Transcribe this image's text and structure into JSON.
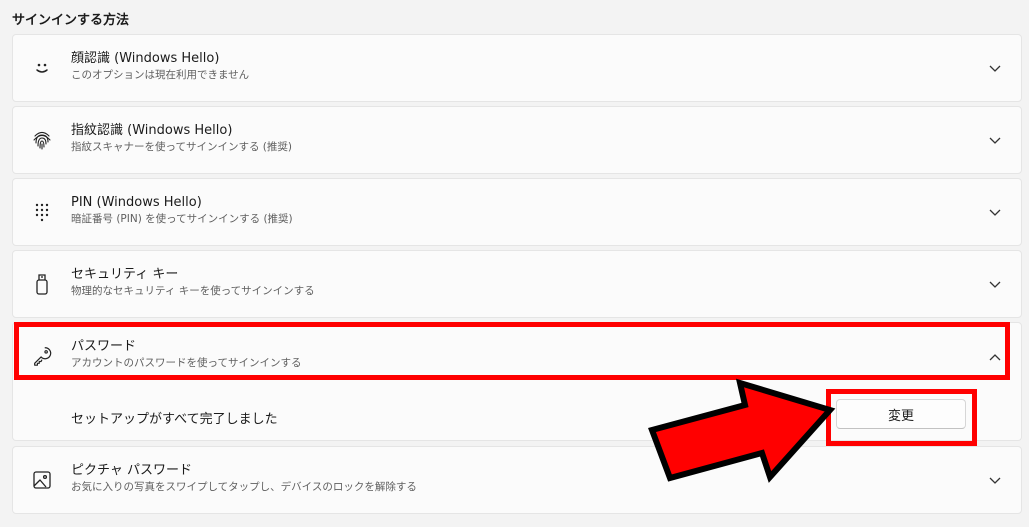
{
  "section_title": "サインインする方法",
  "options": [
    {
      "icon": "face-smile-icon",
      "title": "顔認識 (Windows Hello)",
      "subtitle": "このオプションは現在利用できません"
    },
    {
      "icon": "fingerprint-icon",
      "title": "指紋認識 (Windows Hello)",
      "subtitle": "指紋スキャナーを使ってサインインする (推奨)"
    },
    {
      "icon": "pin-keypad-icon",
      "title": "PIN (Windows Hello)",
      "subtitle": "暗証番号 (PIN) を使ってサインインする (推奨)"
    },
    {
      "icon": "security-key-icon",
      "title": "セキュリティ キー",
      "subtitle": "物理的なセキュリティ キーを使ってサインインする"
    },
    {
      "icon": "key-icon",
      "title": "パスワード",
      "subtitle": "アカウントのパスワードを使ってサインインする"
    },
    {
      "icon": "picture-icon",
      "title": "ピクチャ パスワード",
      "subtitle": "お気に入りの写真をスワイプしてタップし、デバイスのロックを解除する"
    }
  ],
  "password_expanded": {
    "status": "セットアップがすべて完了しました",
    "change_button": "変更"
  },
  "colors": {
    "highlight": "#ff0000",
    "arrow_outline": "#000000"
  }
}
